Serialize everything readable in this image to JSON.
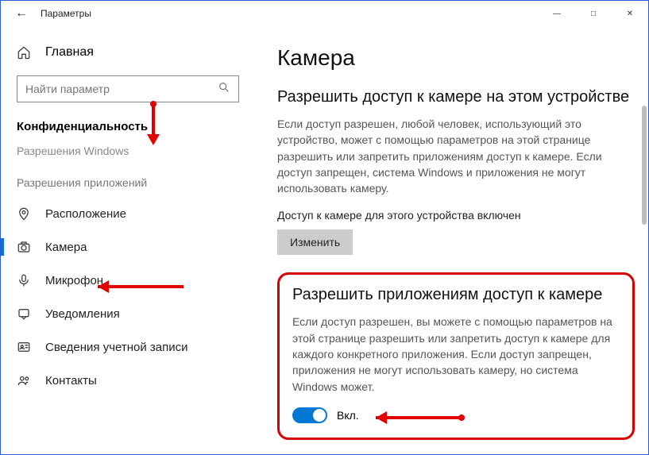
{
  "window": {
    "title": "Параметры"
  },
  "sidebar": {
    "home": "Главная",
    "search_placeholder": "Найти параметр",
    "category": "Конфиденциальность",
    "subcategory": "Разрешения Windows",
    "section": "Разрешения приложений",
    "items": [
      {
        "label": "Расположение"
      },
      {
        "label": "Камера"
      },
      {
        "label": "Микрофон"
      },
      {
        "label": "Уведомления"
      },
      {
        "label": "Сведения учетной записи"
      },
      {
        "label": "Контакты"
      }
    ]
  },
  "main": {
    "title": "Камера",
    "sec1_title": "Разрешить доступ к камере на этом устройстве",
    "sec1_body": "Если доступ разрешен, любой человек, использующий это устройство, может с помощью параметров на этой странице разрешить или запретить приложениям доступ к камере. Если доступ запрещен, система Windows и приложения не могут использовать камеру.",
    "sec1_status": "Доступ к камере для этого устройства включен",
    "change_btn": "Изменить",
    "sec2_title": "Разрешить приложениям доступ к камере",
    "sec2_body": "Если доступ разрешен, вы можете с помощью параметров на этой странице разрешить или запретить доступ к камере для каждого конкретного приложения. Если доступ запрещен, приложения не могут использовать камеру, но система Windows может.",
    "toggle_label": "Вкл."
  }
}
